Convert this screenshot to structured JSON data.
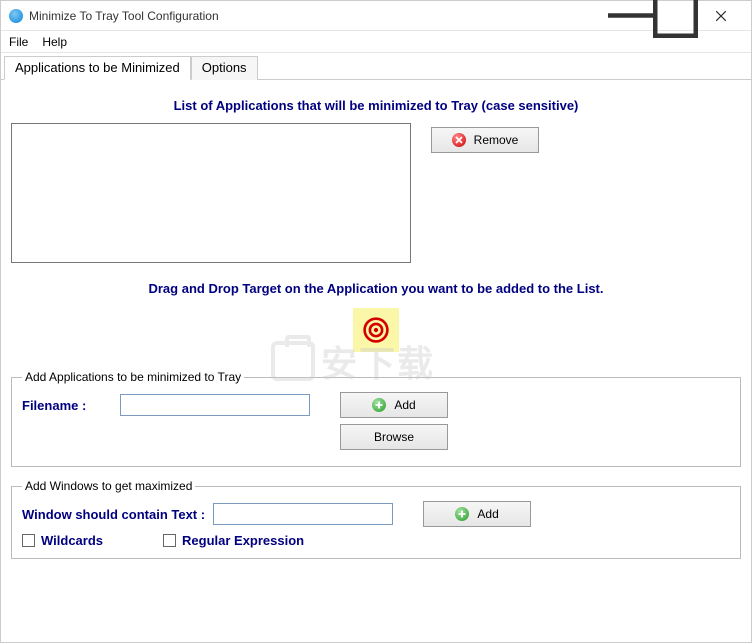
{
  "window": {
    "title": "Minimize To Tray Tool Configuration"
  },
  "menu": {
    "file": "File",
    "help": "Help"
  },
  "tabs": {
    "applications": "Applications to be Minimized",
    "options": "Options"
  },
  "headings": {
    "list_title": "List of Applications that will be minimized to Tray (case sensitive)",
    "drag_instruction": "Drag and Drop Target on the Application you want to be added to the List."
  },
  "buttons": {
    "remove": "Remove",
    "add": "Add",
    "browse": "Browse",
    "add2": "Add"
  },
  "groups": {
    "add_apps": {
      "legend": "Add Applications to be minimized to Tray",
      "filename_label": "Filename :"
    },
    "add_windows": {
      "legend": "Add Windows to get maximized",
      "window_text_label": "Window should contain Text :",
      "wildcards": "Wildcards",
      "regex": "Regular Expression"
    }
  },
  "inputs": {
    "filename_value": "",
    "window_text_value": ""
  },
  "watermark": "安下载"
}
